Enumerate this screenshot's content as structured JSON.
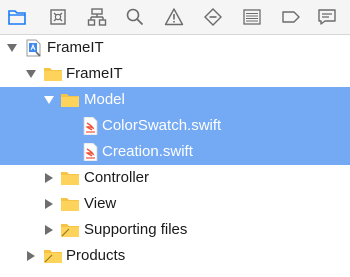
{
  "toolbar": {
    "buttons": [
      {
        "name": "project-navigator",
        "icon": "folder-icon",
        "active": true
      },
      {
        "name": "source-control-navigator",
        "icon": "square-x-icon"
      },
      {
        "name": "symbol-navigator",
        "icon": "hierarchy-icon"
      },
      {
        "name": "find-navigator",
        "icon": "search-icon"
      },
      {
        "name": "issue-navigator",
        "icon": "warning-icon"
      },
      {
        "name": "test-navigator",
        "icon": "diamond-minus-icon"
      },
      {
        "name": "debug-navigator",
        "icon": "list-lines-icon"
      },
      {
        "name": "breakpoint-navigator",
        "icon": "tag-icon"
      },
      {
        "name": "report-navigator",
        "icon": "chat-bubble-icon"
      }
    ],
    "accent_color": "#1a7cf5"
  },
  "tree": {
    "selection_color": "#74a9f4",
    "rows": [
      {
        "label": "FrameIT",
        "kind": "project",
        "expanded": true
      },
      {
        "label": "FrameIT",
        "kind": "folder",
        "expanded": true
      },
      {
        "label": "Model",
        "kind": "folder",
        "expanded": true,
        "selected": true
      },
      {
        "label": "ColorSwatch.swift",
        "kind": "swift-file",
        "selected": true
      },
      {
        "label": "Creation.swift",
        "kind": "swift-file",
        "selected": true
      },
      {
        "label": "Controller",
        "kind": "folder",
        "expanded": false
      },
      {
        "label": "View",
        "kind": "folder",
        "expanded": false
      },
      {
        "label": "Supporting files",
        "kind": "folder",
        "expanded": false
      },
      {
        "label": "Products",
        "kind": "folder",
        "expanded": false
      }
    ]
  }
}
